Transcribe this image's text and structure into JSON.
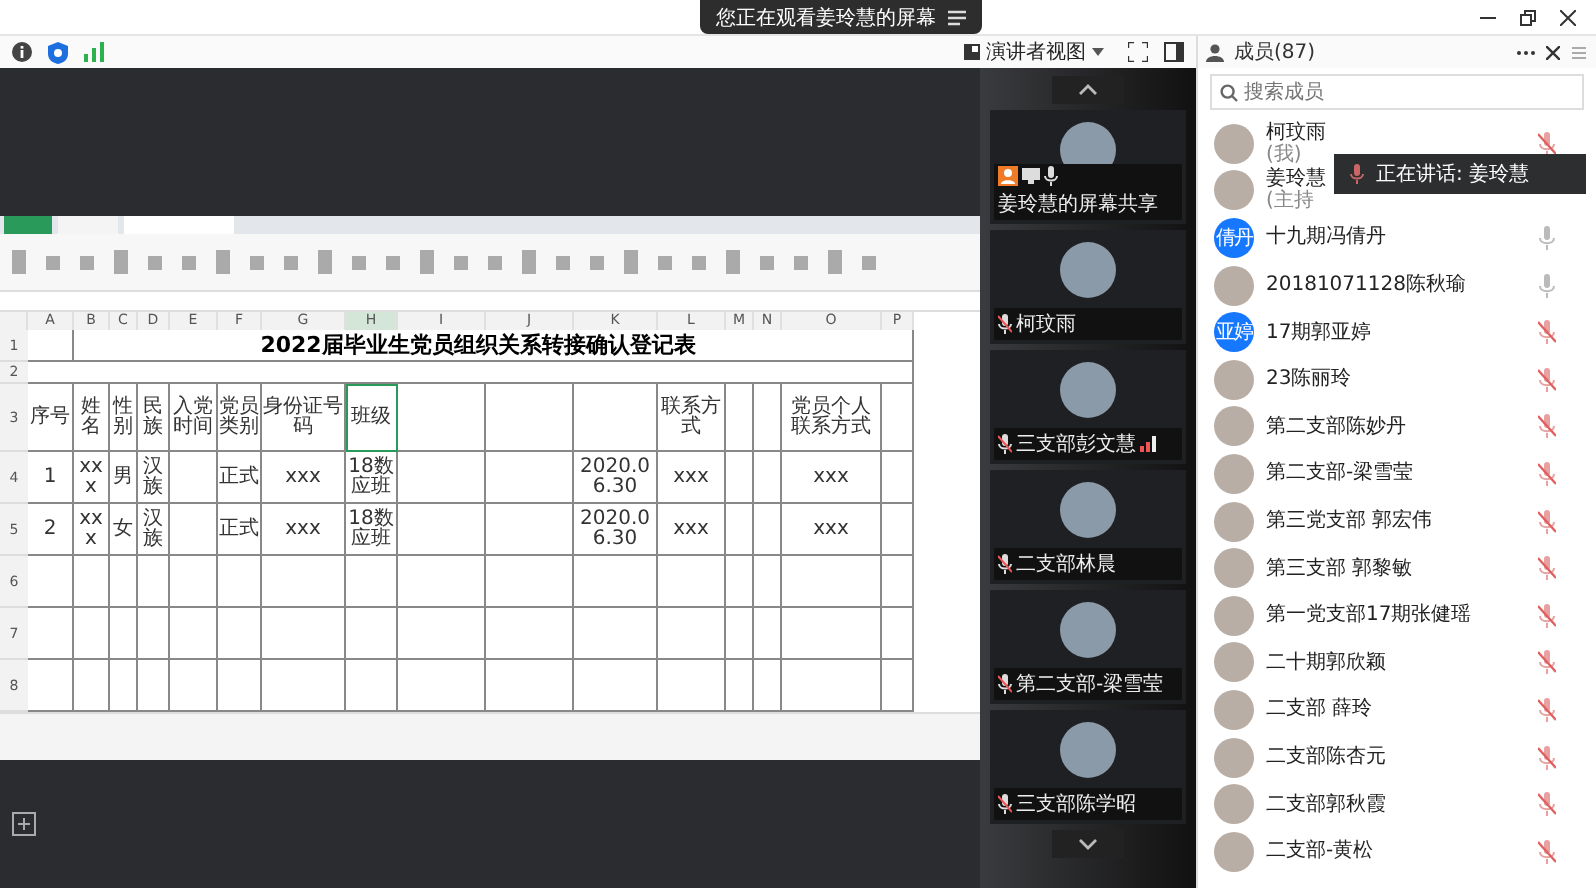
{
  "top_bar": {
    "notice": "您正在观看姜玲慧的屏幕"
  },
  "toolbar": {
    "view_button": "演讲者视图"
  },
  "shared_screen": {
    "sheet": {
      "title": "2022届毕业生党员组织关系转接确认登记表",
      "columns": [
        "A",
        "B",
        "C",
        "D",
        "E",
        "F",
        "G",
        "H",
        "I",
        "J",
        "K",
        "L",
        "M",
        "N",
        "O",
        "P"
      ],
      "title_row": "1",
      "info_row": "2",
      "header_row": {
        "number": "3",
        "col_1": "序号",
        "col_2": "姓名",
        "col_3": "性别",
        "col_4": "民族",
        "col_5": "入党时间",
        "col_6": "党员类别",
        "col_7": "身份证号码",
        "col_8": "班级",
        "col_12": "联系方式",
        "col_15": "党员个人联系方式"
      },
      "rows": [
        {
          "number": "4",
          "col_1": "1",
          "col_2": "xxx",
          "col_3": "男",
          "col_4": "汉族",
          "col_6": "正式",
          "col_7": "xxx",
          "col_8": "18数应班",
          "col_11": "2020.06.30",
          "col_12": "xxx",
          "col_15": "xxx"
        },
        {
          "number": "5",
          "col_1": "2",
          "col_2": "xxx",
          "col_3": "女",
          "col_4": "汉族",
          "col_6": "正式",
          "col_7": "xxx",
          "col_8": "18数应班",
          "col_11": "2020.06.30",
          "col_12": "xxx",
          "col_15": "xxx"
        },
        {
          "number": "6"
        },
        {
          "number": "7"
        },
        {
          "number": "8"
        }
      ]
    }
  },
  "video_tiles": [
    {
      "name": "姜玲慧的屏幕共享",
      "kind": "share",
      "audio_active": false
    },
    {
      "name": "柯玟雨",
      "kind": "person",
      "audio_active": false
    },
    {
      "name": "三支部彭文慧",
      "kind": "person",
      "audio_active": true
    },
    {
      "name": "二支部林晨",
      "kind": "person",
      "audio_active": false
    },
    {
      "name": "第二支部-梁雪莹",
      "kind": "person",
      "audio_active": false
    },
    {
      "name": "三支部陈学昭",
      "kind": "person",
      "audio_active": false
    }
  ],
  "members": {
    "title": "成员(87)",
    "search": {
      "placeholder": "搜索成员"
    },
    "items": [
      {
        "name": "柯玟雨",
        "role": "(我)",
        "muted": true
      },
      {
        "name": "姜玲慧",
        "role": "(主持"
      },
      {
        "name": "十九期冯倩丹",
        "avatar_text": "倩丹",
        "muted": false
      },
      {
        "name": "20181071128陈秋瑜",
        "muted": false
      },
      {
        "name": "17期郭亚婷",
        "avatar_text": "亚婷",
        "muted": true
      },
      {
        "name": "23陈丽玲",
        "muted": true
      },
      {
        "name": "第二支部陈妙丹",
        "muted": true
      },
      {
        "name": "第二支部-梁雪莹",
        "muted": true
      },
      {
        "name": "第三党支部 郭宏伟",
        "muted": true
      },
      {
        "name": "第三支部 郭黎敏",
        "muted": true
      },
      {
        "name": "第一党支部17期张健瑶",
        "muted": true
      },
      {
        "name": "二十期郭欣颖",
        "muted": true
      },
      {
        "name": "二支部 薛玲",
        "muted": true
      },
      {
        "name": "二支部陈杏元",
        "muted": true
      },
      {
        "name": "二支部郭秋霞",
        "muted": true
      },
      {
        "name": "二支部-黄松",
        "muted": true
      }
    ]
  },
  "speaking_toast": {
    "text": "正在讲话: 姜玲慧"
  }
}
